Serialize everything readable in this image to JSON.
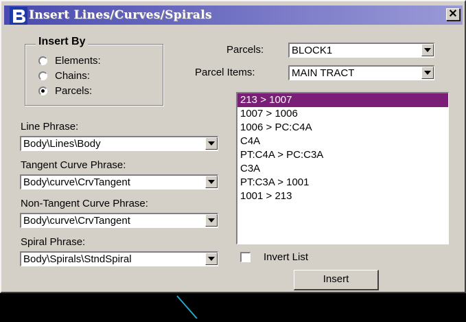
{
  "window": {
    "title": "Insert Lines/Curves/Spirals",
    "titlebar_color": "#4a4ab0",
    "icon": "bentley-b-icon",
    "close_label": "✕"
  },
  "insert_by": {
    "legend": "Insert By",
    "options": [
      {
        "label": "Elements:",
        "selected": false
      },
      {
        "label": "Chains:",
        "selected": false
      },
      {
        "label": "Parcels:",
        "selected": true
      }
    ]
  },
  "parcels": {
    "label": "Parcels:",
    "value": "BLOCK1"
  },
  "parcel_items": {
    "label": "Parcel Items:",
    "value": "MAIN TRACT"
  },
  "phrases": [
    {
      "label": "Line Phrase:",
      "value": "Body\\Lines\\Body"
    },
    {
      "label": "Tangent Curve Phrase:",
      "value": "Body\\curve\\CrvTangent"
    },
    {
      "label": "Non-Tangent Curve Phrase:",
      "value": "Body\\curve\\CrvTangent"
    },
    {
      "label": "Spiral Phrase:",
      "value": "Body\\Spirals\\StndSpiral"
    }
  ],
  "item_list": {
    "items": [
      "213 > 1007",
      "1007 > 1006",
      "1006 > PC:C4A",
      "C4A",
      "PT:C4A > PC:C3A",
      "C3A",
      "PT:C3A > 1001",
      "1001 > 213"
    ],
    "selected_index": 0,
    "selection_color": "#7b1e78"
  },
  "invert_list": {
    "label": "Invert List",
    "checked": false
  },
  "insert_button": {
    "label": "Insert"
  },
  "background_line_color": "#22a8c8"
}
